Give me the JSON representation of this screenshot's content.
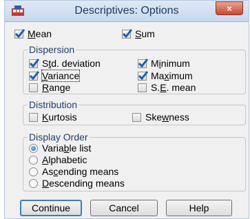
{
  "window": {
    "title": "Descriptives: Options",
    "close_glyph": "×"
  },
  "top_options": [
    {
      "pre": "",
      "accel": "M",
      "post": "ean",
      "checked": true
    },
    {
      "pre": "",
      "accel": "S",
      "post": "um",
      "checked": true
    }
  ],
  "dispersion": {
    "legend": "Dispersion",
    "items": [
      {
        "pre": "S",
        "accel": "t",
        "post": "d. deviation",
        "checked": true
      },
      {
        "pre": "M",
        "accel": "i",
        "post": "nimum",
        "checked": true
      },
      {
        "pre": "",
        "accel": "V",
        "post": "ariance",
        "checked": true
      },
      {
        "pre": "Ma",
        "accel": "x",
        "post": "imum",
        "checked": true
      },
      {
        "pre": "",
        "accel": "R",
        "post": "ange",
        "checked": false
      },
      {
        "pre": "S.",
        "accel": "E",
        "post": ". mean",
        "checked": false
      }
    ]
  },
  "distribution": {
    "legend": "Distribution",
    "items": [
      {
        "pre": "",
        "accel": "K",
        "post": "urtosis",
        "checked": false
      },
      {
        "pre": "Ske",
        "accel": "w",
        "post": "ness",
        "checked": false
      }
    ]
  },
  "display_order": {
    "legend": "Display Order",
    "items": [
      {
        "pre": "Varia",
        "accel": "b",
        "post": "le list",
        "selected": true
      },
      {
        "pre": "",
        "accel": "A",
        "post": "lphabetic",
        "selected": false
      },
      {
        "pre": "As",
        "accel": "c",
        "post": "ending means",
        "selected": false
      },
      {
        "pre": "",
        "accel": "D",
        "post": "escending means",
        "selected": false
      }
    ]
  },
  "buttons": {
    "continue": "Continue",
    "cancel": "Cancel",
    "help": "Help"
  },
  "colors": {
    "check": "#1a5fb4",
    "accent": "#3c7fb1",
    "close": "#c7472e"
  },
  "icons": {
    "app": "spss-app-icon",
    "close": "close-icon",
    "check": "checkmark-icon"
  }
}
